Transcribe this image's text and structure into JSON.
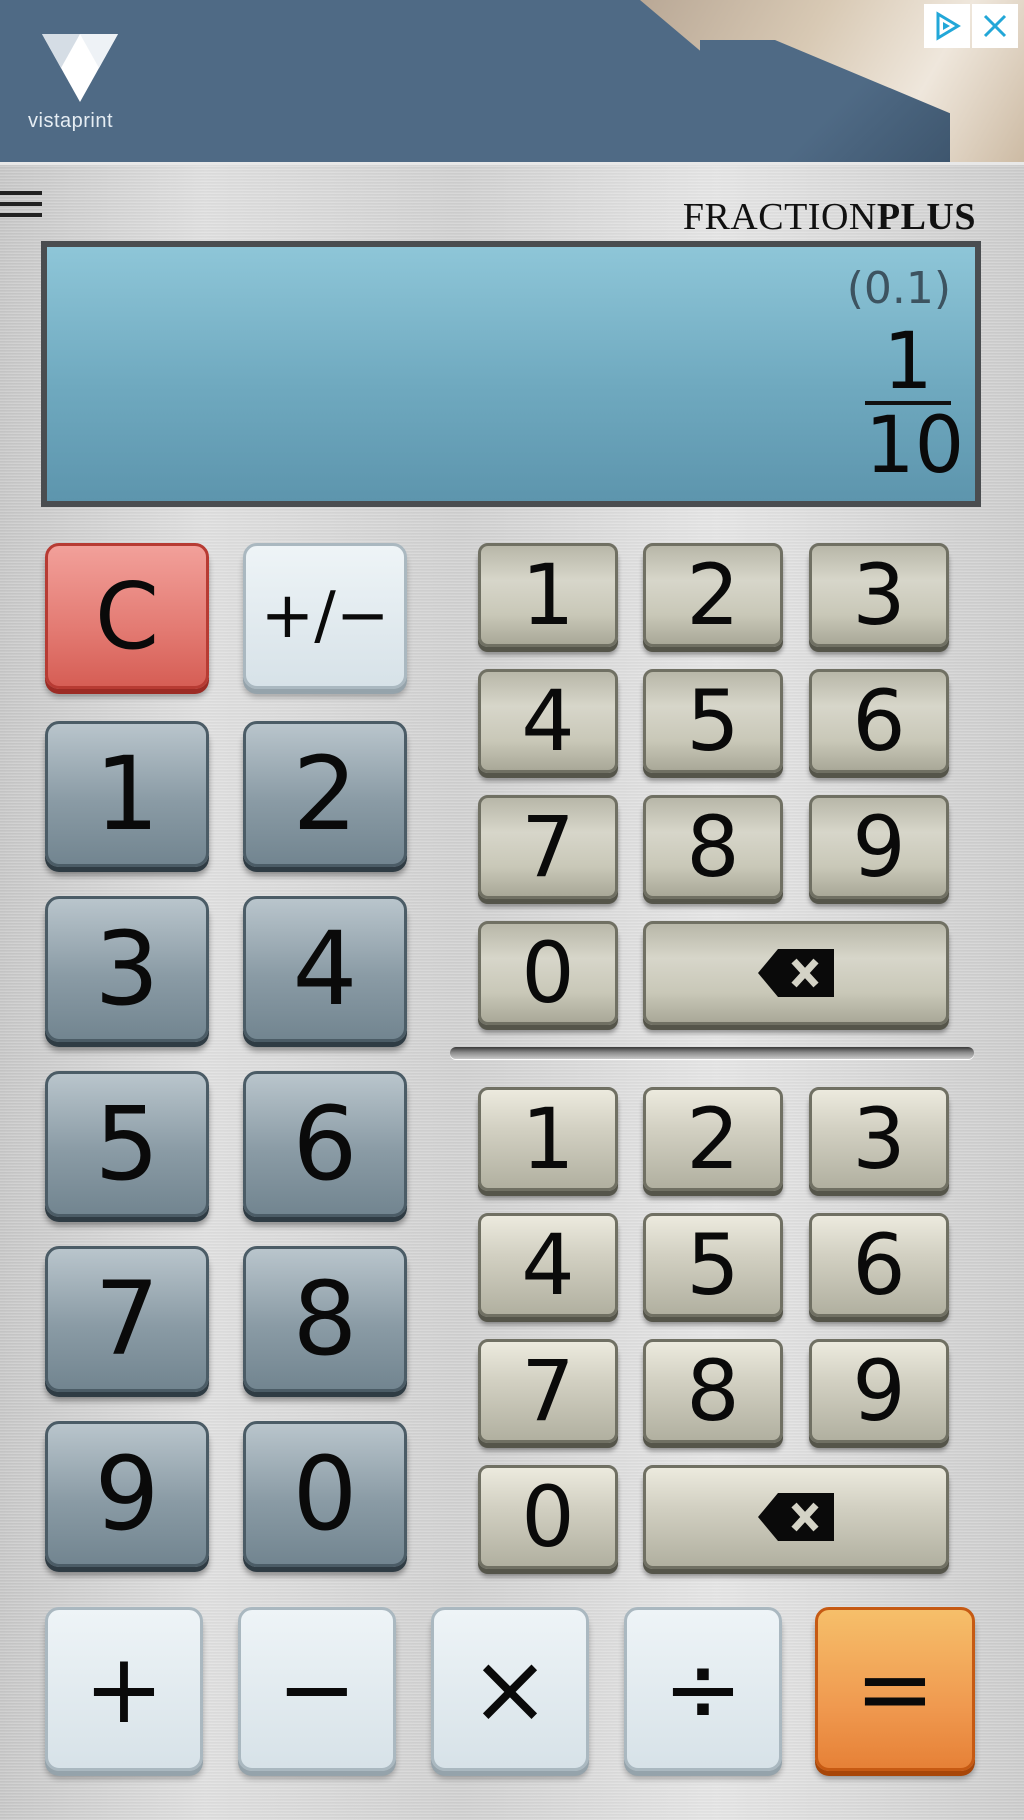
{
  "ad": {
    "brand": "vistaprint",
    "adchoices_icon": "adchoices-icon",
    "close_icon": "close-icon"
  },
  "app": {
    "menu_icon": "hamburger-menu-icon",
    "brand_light": "FRACTION",
    "brand_bold": "PLUS"
  },
  "display": {
    "decimal": "(0.1)",
    "numerator": "1",
    "denominator": "10"
  },
  "left_keypad": {
    "clear": "C",
    "sign": "+/−",
    "digits": [
      "1",
      "2",
      "3",
      "4",
      "5",
      "6",
      "7",
      "8",
      "9",
      "0"
    ]
  },
  "numerator_keypad": {
    "digits": [
      "1",
      "2",
      "3",
      "4",
      "5",
      "6",
      "7",
      "8",
      "9",
      "0"
    ],
    "backspace_icon": "backspace-icon"
  },
  "denominator_keypad": {
    "digits": [
      "1",
      "2",
      "3",
      "4",
      "5",
      "6",
      "7",
      "8",
      "9",
      "0"
    ],
    "backspace_icon": "backspace-icon"
  },
  "operators": {
    "plus": "+",
    "minus": "−",
    "times": "×",
    "divide": "÷",
    "equals": "="
  },
  "colors": {
    "clear": "#e37a72",
    "equals": "#f09a50",
    "display": "#7ab7cc"
  }
}
